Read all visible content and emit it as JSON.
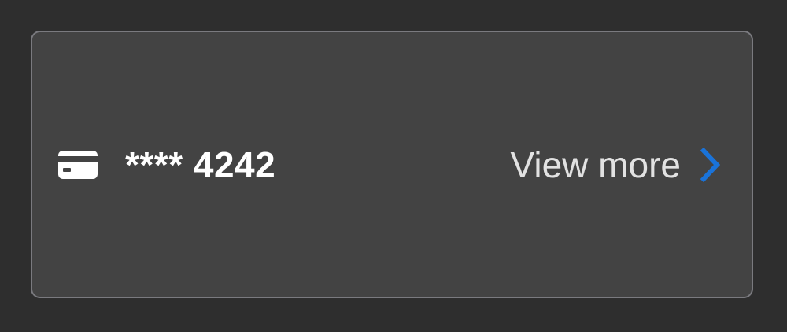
{
  "payment_card": {
    "masked_number": "**** 4242",
    "icon": "credit-card-icon",
    "link": {
      "label": "View more",
      "icon": "chevron-right-icon"
    }
  },
  "colors": {
    "background": "#2e2e2e",
    "card_background": "#434343",
    "card_border": "#7a7a7f",
    "accent": "#1a73d9",
    "text_primary": "#ffffff",
    "text_secondary": "#e2e2e2"
  }
}
